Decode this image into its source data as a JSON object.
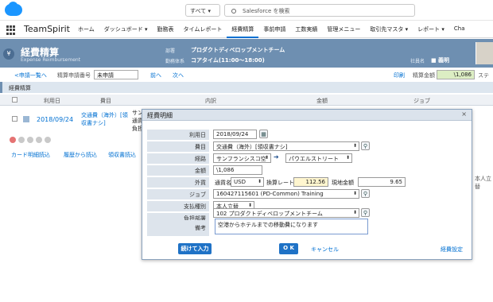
{
  "topbar": {
    "scope_label": "すべて ▾",
    "search_placeholder": "Salesforce を検索"
  },
  "nav": {
    "app_name": "TeamSpirit",
    "tabs": [
      "ホーム",
      "ダッシュボード ▾",
      "勤務表",
      "タイムレポート",
      "経費精算",
      "事前申請",
      "工数実績",
      "管理メニュー",
      "取引先マスタ ▾",
      "レポート ▾",
      "Cha"
    ],
    "active_index": 4
  },
  "header": {
    "icon": "¥",
    "title": "経費精算",
    "subtitle": "Expense Reimbursement",
    "dept_label": "部署",
    "dept_value": "プロダクトディベロップメントチーム",
    "work_label": "勤務体系",
    "work_value": "コアタイム(11:00～18:00)",
    "employee_label": "社員名",
    "employee_value": "■ 義明"
  },
  "toolbar": {
    "prev_list": "<申請一覧へ",
    "request_no_label": "精算申請番号",
    "request_select": "未申請",
    "prev": "前へ",
    "next": "次へ",
    "print": "印刷",
    "total_label": "精算金額",
    "total_value": "\\1,086",
    "status_label": "ステー"
  },
  "section": {
    "title": "経費精算"
  },
  "table": {
    "headers": [
      "利用日",
      "費目",
      "内訳",
      "金額",
      "ジョブ"
    ],
    "row": {
      "date": "2018/09/24",
      "expense_line1": "交通費（海外）[領",
      "expense_line2": "収書ナシ]",
      "detail_line1": "サン",
      "detail_line2": "通貨",
      "detail_line3": "負担"
    },
    "links": [
      "カード明細読込",
      "履歴から読込",
      "領収書読込"
    ],
    "right_note": "本人立替"
  },
  "dialog": {
    "title": "経費明細",
    "close": "×",
    "labels": {
      "date": "利用日",
      "expense": "費目",
      "route": "経路",
      "amount": "金額",
      "foreign": "外貨",
      "job": "ジョブ",
      "payment": "支払種別",
      "dept": "負担部署",
      "memo": "備考"
    },
    "values": {
      "date": "2018/09/24",
      "expense": "交通費（海外）[領収書ナシ]",
      "route_from": "サンフランシスコ空",
      "route_arrow": "➔",
      "route_to": "パウエルストリート",
      "amount": "\\1,086",
      "currency_label": "通貨名",
      "currency": "USD",
      "rate_label": "換算レート",
      "rate": "112.56",
      "local_label": "現地金額",
      "local": "9.65",
      "job": "160427115601  (PD-Common)  Training",
      "payment": "本人立替",
      "dept": "102 プロダクトディベロップメントチーム",
      "memo": "空港からホテルまでの移動費になります"
    },
    "buttons": {
      "continue": "続けて入力",
      "ok": "O K",
      "cancel": "キャンセル",
      "settings": "経費設定"
    }
  }
}
